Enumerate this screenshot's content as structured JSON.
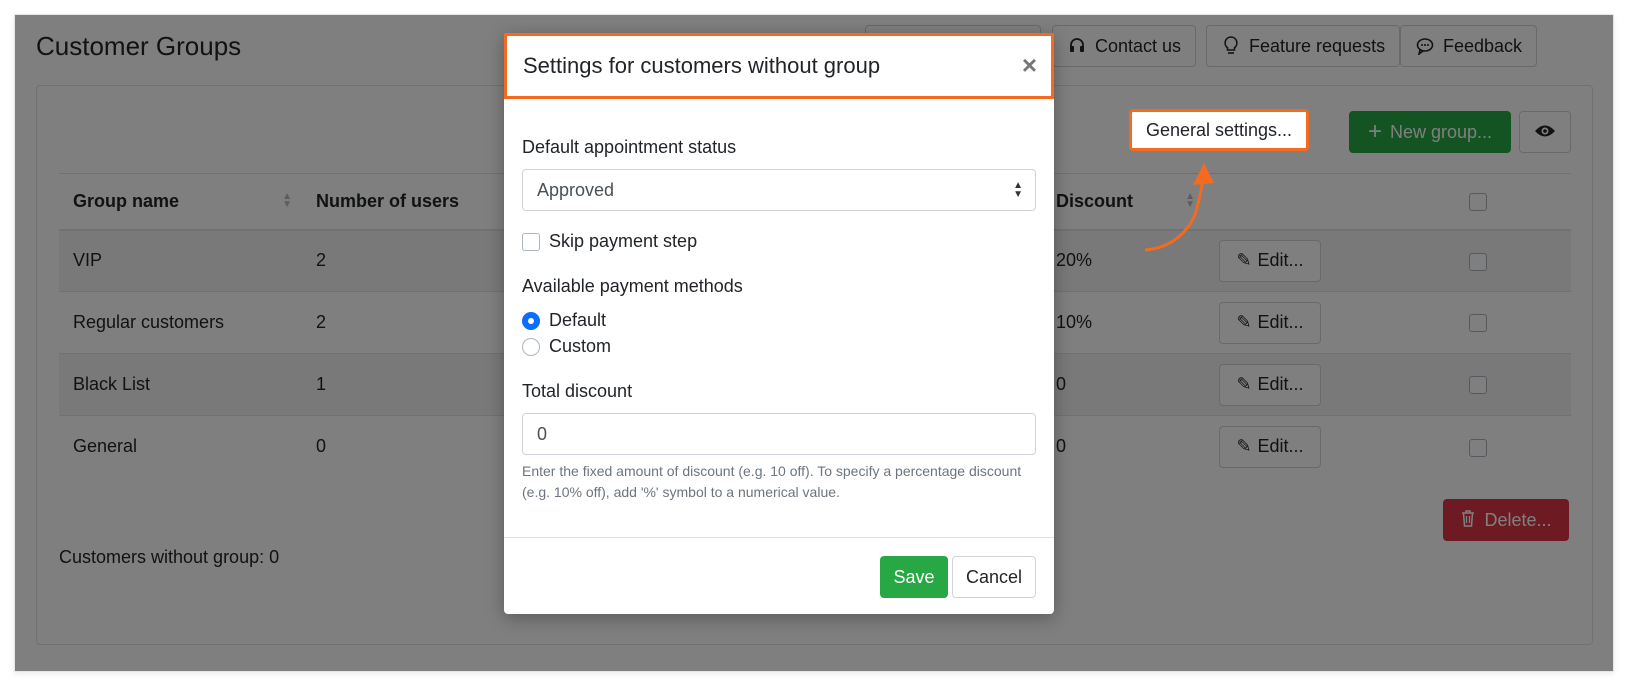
{
  "page": {
    "title": "Customer Groups"
  },
  "top_buttons": {
    "contact": "Contact us",
    "feature": "Feature requests",
    "feedback": "Feedback"
  },
  "toolbar": {
    "general_settings": "General settings...",
    "new_group": "New group...",
    "delete": "Delete..."
  },
  "table": {
    "headers": {
      "group_name": "Group name",
      "users": "Number of users",
      "discount": "Discount"
    },
    "rows": [
      {
        "name": "VIP",
        "users": "2",
        "discount": "20%",
        "edit": "Edit..."
      },
      {
        "name": "Regular customers",
        "users": "2",
        "discount": "10%",
        "edit": "Edit..."
      },
      {
        "name": "Black List",
        "users": "1",
        "discount": "0",
        "edit": "Edit..."
      },
      {
        "name": "General",
        "users": "0",
        "discount": "0",
        "edit": "Edit..."
      }
    ]
  },
  "footer": {
    "no_group": "Customers without group: 0"
  },
  "modal": {
    "title": "Settings for customers without group",
    "status_label": "Default appointment status",
    "status_value": "Approved",
    "skip_payment_label": "Skip payment step",
    "payment_methods_label": "Available payment methods",
    "payment_default": "Default",
    "payment_custom": "Custom",
    "discount_label": "Total discount",
    "discount_value": "0",
    "discount_help": "Enter the fixed amount of discount (e.g. 10 off). To specify a percentage discount (e.g. 10% off), add '%' symbol to a numerical value.",
    "save": "Save",
    "cancel": "Cancel"
  },
  "colors": {
    "highlight": "#f26b21",
    "success": "#28a745",
    "danger": "#dc3545",
    "primary": "#0d6efd"
  }
}
